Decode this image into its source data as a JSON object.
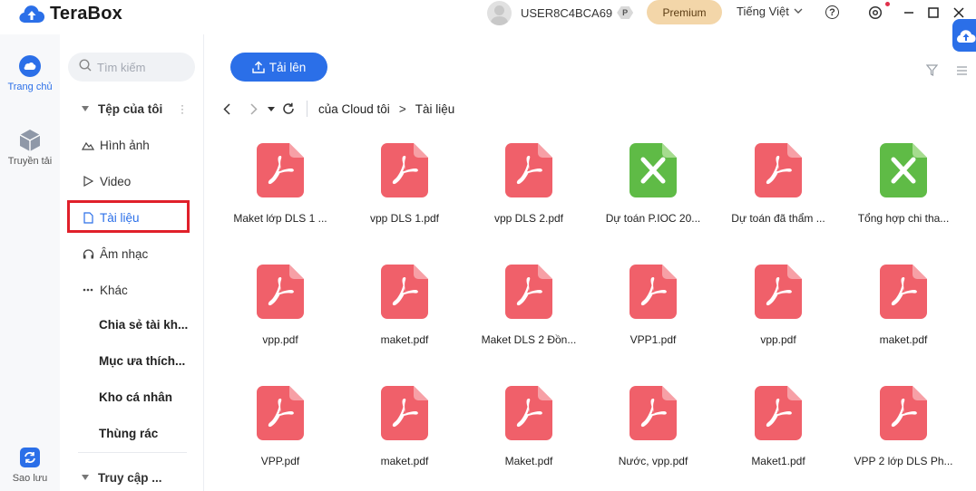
{
  "app": {
    "name": "TeraBox"
  },
  "header": {
    "username": "USER8C4BCA69",
    "badge": "P",
    "premium_label": "Premium",
    "language": "Tiếng Việt",
    "help_label": "?"
  },
  "rail": {
    "home": "Trang chủ",
    "transfer": "Truyền tải",
    "backup": "Sao lưu"
  },
  "sidebar": {
    "search_placeholder": "Tìm kiếm",
    "my_files": "Tệp của tôi",
    "items": [
      {
        "label": "Hình ảnh"
      },
      {
        "label": "Video"
      },
      {
        "label": "Tài liệu"
      },
      {
        "label": "Âm nhạc"
      },
      {
        "label": "Khác"
      }
    ],
    "sections": [
      {
        "label": "Chia sẻ tài kh..."
      },
      {
        "label": "Mục ưa thích..."
      },
      {
        "label": "Kho cá nhân"
      },
      {
        "label": "Thùng rác"
      }
    ],
    "quick_access": "Truy cập ..."
  },
  "toolbar": {
    "upload_label": "Tải lên"
  },
  "breadcrumb": {
    "root": "của Cloud tôi",
    "sep": ">",
    "current": "Tài liệu"
  },
  "files": [
    {
      "name": "Maket lớp DLS 1 ...",
      "type": "pdf"
    },
    {
      "name": "vpp DLS 1.pdf",
      "type": "pdf"
    },
    {
      "name": "vpp DLS 2.pdf",
      "type": "pdf"
    },
    {
      "name": "Dự toán P.IOC 20...",
      "type": "xls"
    },
    {
      "name": "Dự toán đã thẩm ...",
      "type": "pdf"
    },
    {
      "name": "Tổng hợp chi tha...",
      "type": "xls"
    },
    {
      "name": "vpp.pdf",
      "type": "pdf"
    },
    {
      "name": "maket.pdf",
      "type": "pdf"
    },
    {
      "name": "Maket DLS 2 Đồn...",
      "type": "pdf"
    },
    {
      "name": "VPP1.pdf",
      "type": "pdf"
    },
    {
      "name": "vpp.pdf",
      "type": "pdf"
    },
    {
      "name": "maket.pdf",
      "type": "pdf"
    },
    {
      "name": "VPP.pdf",
      "type": "pdf"
    },
    {
      "name": "maket.pdf",
      "type": "pdf"
    },
    {
      "name": "Maket.pdf",
      "type": "pdf"
    },
    {
      "name": "Nước, vpp.pdf",
      "type": "pdf"
    },
    {
      "name": "Maket1.pdf",
      "type": "pdf"
    },
    {
      "name": "VPP 2 lớp DLS Ph...",
      "type": "pdf"
    }
  ],
  "colors": {
    "accent": "#2b6fe8",
    "pdf": "#f0606a",
    "xls": "#5fbb46",
    "highlight_box": "#e0202a",
    "premium_bg": "#f3d6a9"
  }
}
